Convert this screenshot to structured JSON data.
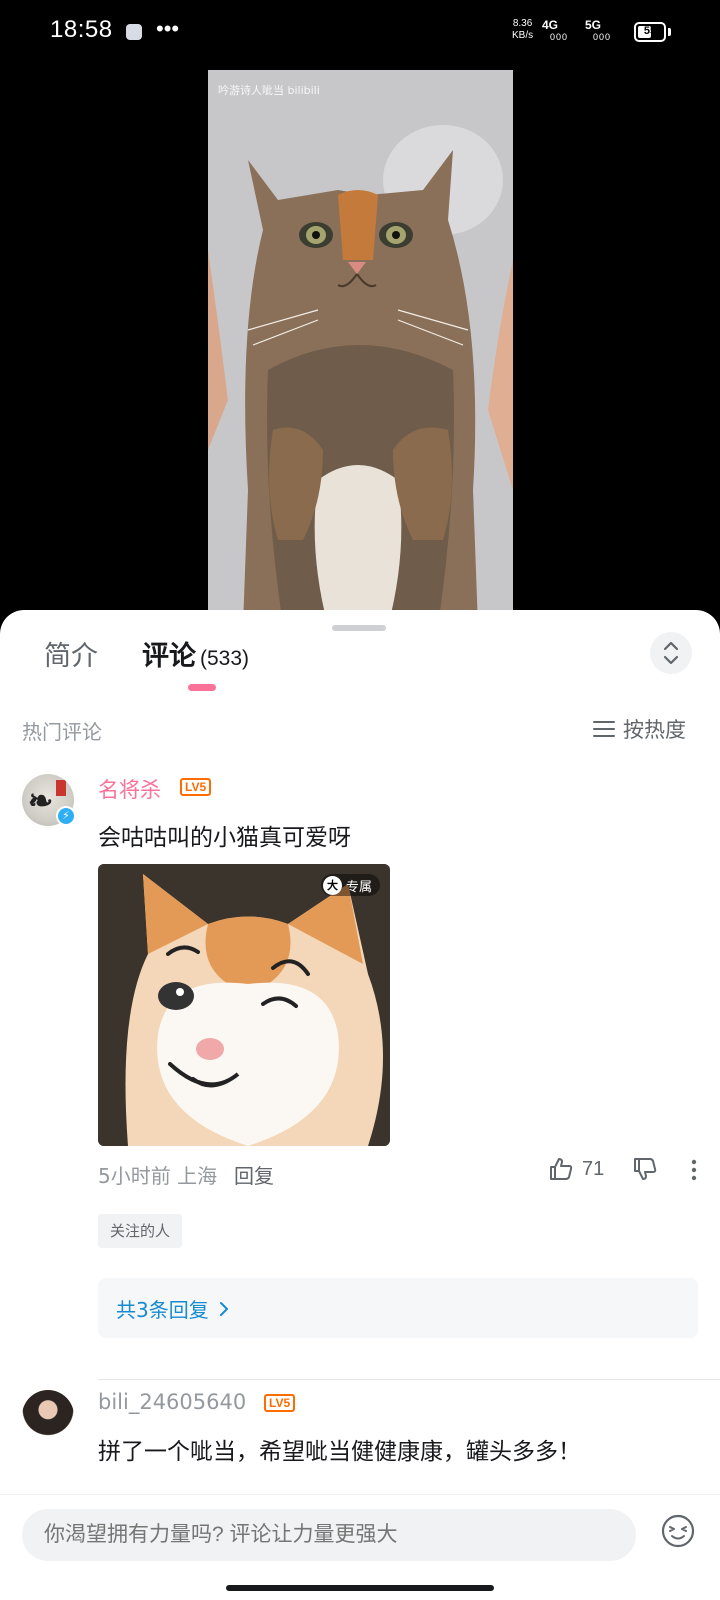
{
  "status_bar": {
    "time": "18:58",
    "dots": "•••",
    "net_speed_value": "8.36",
    "net_speed_unit": "KB/s",
    "signal_1": "4G",
    "signal_2": "5G",
    "signal_sub": "000",
    "battery": "55",
    "battery_level": 0.55
  },
  "video": {
    "watermark": "吟游诗人呲当 bilibili"
  },
  "tabs": {
    "intro": "简介",
    "comments": "评论",
    "comment_count": "(533)"
  },
  "section": {
    "title": "热门评论",
    "sort": "按热度"
  },
  "comments": [
    {
      "username": "名将杀",
      "level": "LV5",
      "text": "会咕咕叫的小猫真可爱呀",
      "image_badge_icon": "大",
      "image_badge": "专属",
      "meta": "5小时前 上海",
      "reply": "回复",
      "likes": "71",
      "tag": "关注的人",
      "replies_link": "共3条回复"
    },
    {
      "username": "bili_24605640",
      "level": "LV5",
      "text": "拼了一个呲当，希望呲当健健康康，罐头多多！"
    }
  ],
  "input": {
    "placeholder": "你渴望拥有力量吗? 评论让力量更强大"
  },
  "colors": {
    "accent_pink": "#fb7299",
    "link_blue": "#178bcf",
    "level_orange": "#ff6c00"
  },
  "icons": [
    "app-notification-icon",
    "more-dots-icon",
    "battery-icon",
    "expand-collapse-icon",
    "sort-lines-icon",
    "verified-icon",
    "thumbs-up-icon",
    "thumbs-down-icon",
    "more-vertical-icon",
    "chevron-right-icon",
    "emoji-icon"
  ]
}
